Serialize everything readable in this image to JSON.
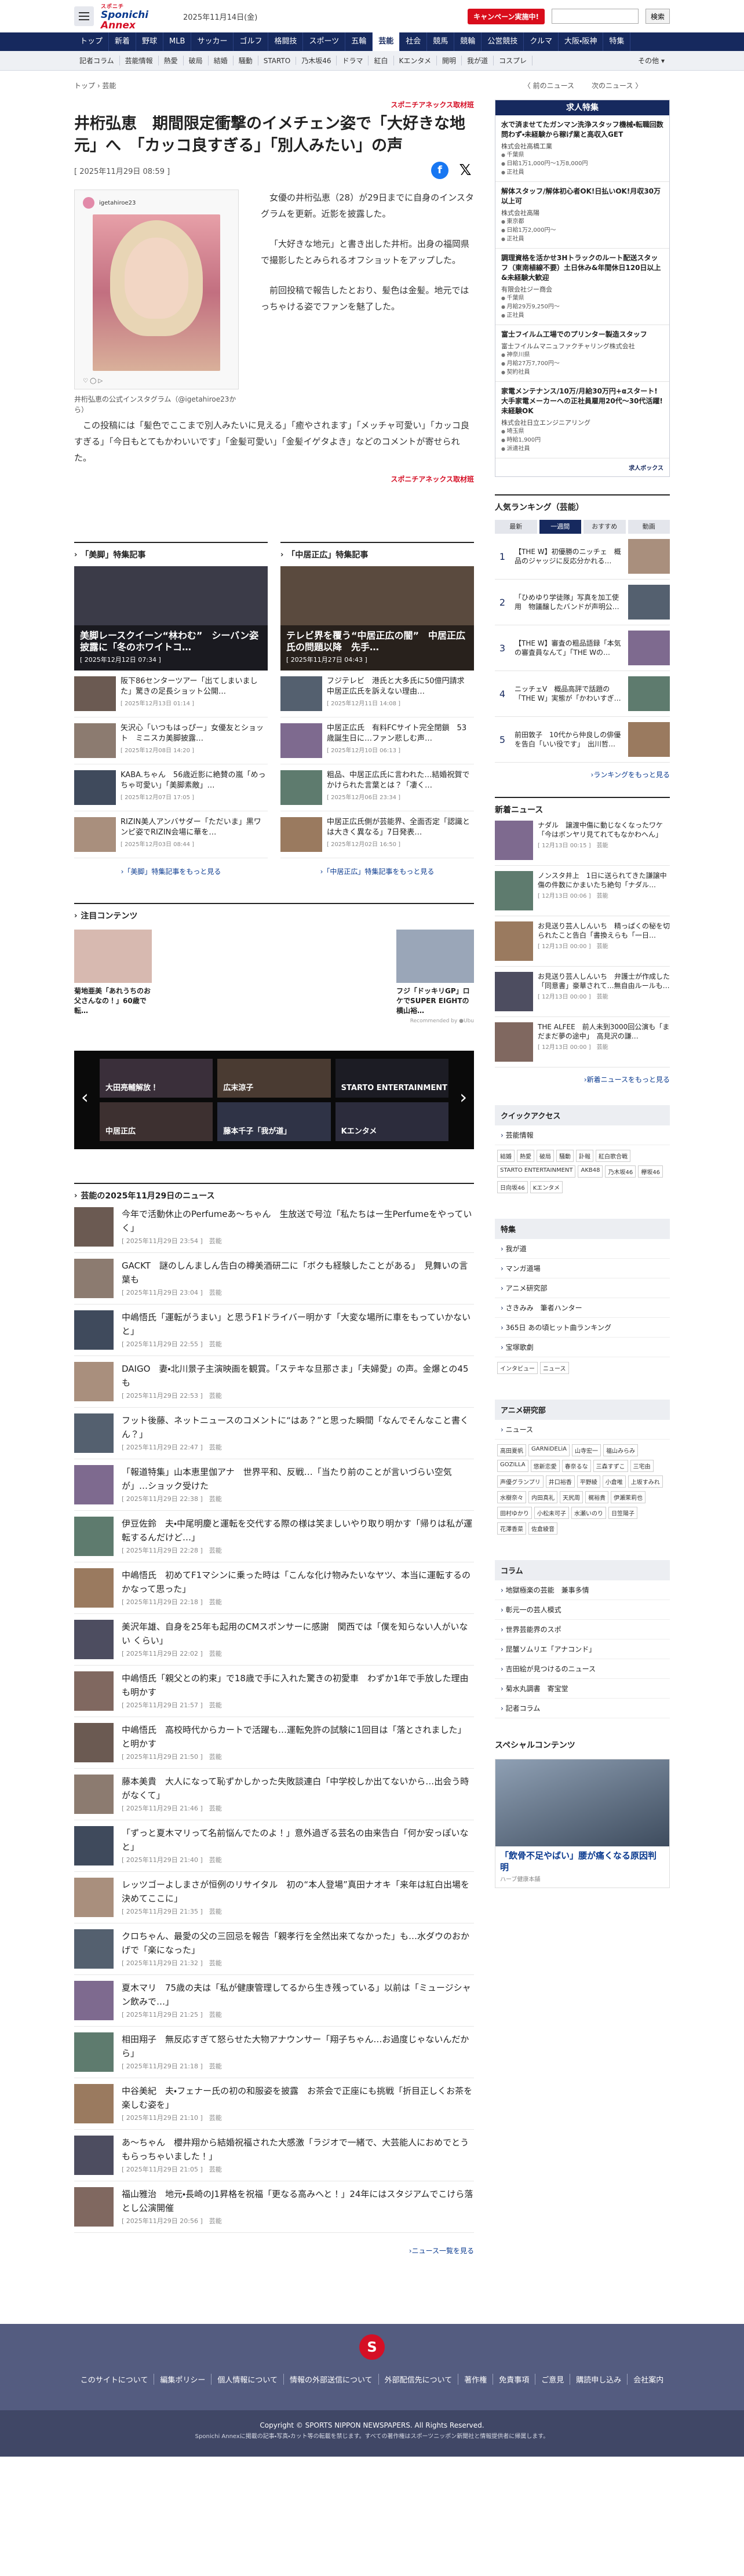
{
  "header": {
    "logo_line1": "スポニチ",
    "logo_line2a": "Sponichi",
    "logo_line2b": "Annex",
    "date": "2025年11月14日(金)",
    "campaign": "キャンペーン実施中!",
    "search_button": "検索"
  },
  "gnav": [
    "トップ",
    "新着",
    "野球",
    "MLB",
    "サッカー",
    "ゴルフ",
    "格闘技",
    "スポーツ",
    "五輪",
    "芸能",
    "社会",
    "競馬",
    "競輪",
    "公営競技",
    "クルマ",
    "大阪・阪神",
    "特集"
  ],
  "subnav": [
    "記者コラム",
    "芸能情報",
    "熱愛",
    "破局",
    "結婚",
    "騒動",
    "STARTO",
    "乃木坂46",
    "ドラマ",
    "紅白",
    "Kエンタメ",
    "開明",
    "我が道",
    "コスプレ"
  ],
  "subnav_more": "その他 ▾",
  "breadcrumb": "トップ  ›  芸能",
  "pager": {
    "prev": "〈  前のニュース",
    "next": "次のニュース  〉"
  },
  "article": {
    "source": "スポニチアネックス取材班",
    "title": "井桁弘恵　期間限定衝撃のイメチェン姿で「大好きな地元」へ　「カッコ良すぎる」「別人みたい」の声",
    "date": "[ 2025年11月29日 08:59 ]",
    "insta_user": "igetahiroe23",
    "insta_caption": "井桁弘恵の公式インスタグラム（@igetahiroe23から）",
    "p1": "女優の井桁弘恵（28）が29日までに自身のインスタグラムを更新。近影を披露した。",
    "p2": "「大好きな地元」と書き出した井桁。出身の福岡県で撮影したとみられるオフショットをアップした。",
    "p3": "前回投稿で報告したとおり、髪色は金髪。地元ではっちゃける姿でファンを魅了した。",
    "p4": "この投稿には「髪色でここまで別人みたいに見える」「癒やされます」「メッチャ可愛い」「カッコ良すぎる」「今日もとてもかわいいです」「金髪可愛い」「金髪イゲタよき」などのコメントが寄せられた。",
    "source2": "スポニチアネックス取材班"
  },
  "features": [
    {
      "head": "「美脚」特集記事",
      "hero_title": "美脚レースクイーン“林わむ”　シーバン姿披露に「冬のホワイトコ…",
      "hero_date": "[ 2025年12月12日 07:34 ]",
      "items": [
        {
          "t": "阪下86センターツアー「出てしまいました」驚きの足長ショット公開…",
          "d": "[ 2025年12月13日 01:14 ]"
        },
        {
          "t": "矢沢心「いつもはっぴー」女優友とショット　ミニスカ美脚披露…",
          "d": "[ 2025年12月08日 14:20 ]"
        },
        {
          "t": "KABA.ちゃん　56歳近影に絶賛の嵐「めっちゃ可愛い」「美脚素敵」…",
          "d": "[ 2025年12月07日 17:05 ]"
        },
        {
          "t": "RIZIN美人アンバサダー「ただいま」黒ワンピ姿でRIZIN会場に華を…",
          "d": "[ 2025年12月03日 08:44 ]"
        }
      ],
      "more": "›「美脚」特集記事をもっと見る"
    },
    {
      "head": "「中居正広」特集記事",
      "hero_title": "テレビ界を覆う“中居正広の闇”　中居正広氏の問題以降　先手…",
      "hero_date": "[ 2025年11月27日 04:43 ]",
      "items": [
        {
          "t": "フジテレビ　港氏と大多氏に50億円請求　中居正広氏を訴えない理由…",
          "d": "[ 2025年12月11日 14:08 ]"
        },
        {
          "t": "中居正広氏　有料FCサイト完全閉鎖　53歳誕生日に…ファン悲しむ声…",
          "d": "[ 2025年12月10日 06:13 ]"
        },
        {
          "t": "粗品、中居正広氏に言われた…結婚祝賀でかけられた言葉とは？「凄く…",
          "d": "[ 2025年12月06日 23:34 ]"
        },
        {
          "t": "中居正広氏側が芸能界、全面否定「認識とは大きく異なる」7日発表…",
          "d": "[ 2025年12月02日 16:50 ]"
        }
      ],
      "more": "›「中居正広」特集記事をもっと見る"
    }
  ],
  "attention": {
    "head": "注目コンテンツ",
    "items": [
      {
        "t": "菊地亜美「あれうちのお父さんなの！」60歳で転…"
      },
      {
        "t": ""
      },
      {
        "t": ""
      },
      {
        "t": "フジ「ドッキリGP」ロケでSUPER EIGHTの横山裕…"
      }
    ],
    "note": "Recommended by ●Ubu"
  },
  "carousel": [
    "大田亮輔解放！",
    "広末涼子",
    "STARTO ENTERTAINMENT",
    "中居正広",
    "藤本千子「我が道」",
    "Kエンタメ"
  ],
  "newslist": {
    "head": "芸能の2025年11月29日のニュース",
    "items": [
      {
        "t": "今年で活動休止のPerfumeあ～ちゃん　生放送で号泣「私たちはー生Perfumeをやっていく」",
        "d": "[ 2025年11月29日 23:54 ]　芸能"
      },
      {
        "t": "GACKT　謎のしんましん告白の樽美酒研二に「ボクも経験したことがある」　見舞いの言葉も",
        "d": "[ 2025年11月29日 23:04 ]　芸能"
      },
      {
        "t": "中嶋悟氏「運転がうまい」と思うF1ドライバー明かす「大変な場所に車をもっていかないと」",
        "d": "[ 2025年11月29日 22:55 ]　芸能"
      },
      {
        "t": "DAIGO　妻・北川景子主演映画を観賞。「ステキな旦那さま」「夫婦愛」の声。金爆との45も",
        "d": "[ 2025年11月29日 22:53 ]　芸能"
      },
      {
        "t": "フット後藤、ネットニュースのコメントに“はあ？”と思った瞬間「なんでそんなこと書くん？」",
        "d": "[ 2025年11月29日 22:47 ]　芸能"
      },
      {
        "t": "「報道特集」山本恵里伽アナ　世界平和、反戦…「当たり前のことが言いづらい空気が」…ショック受けた",
        "d": "[ 2025年11月29日 22:38 ]　芸能"
      },
      {
        "t": "伊豆佐鈴　夫・中尾明慶と運転を交代する際の様は笑ましいやり取り明かす「帰りは私が運転するんだけど…」",
        "d": "[ 2025年11月29日 22:28 ]　芸能"
      },
      {
        "t": "中嶋悟氏　初めてF1マシンに乗った時は「こんな化け物みたいなヤツ、本当に運転するのかなって思った」",
        "d": "[ 2025年11月29日 22:18 ]　芸能"
      },
      {
        "t": "美沢年雄、自身を25年も起用のCMスポンサーに感謝　関西では「僕を知らない人がいない くらい」",
        "d": "[ 2025年11月29日 22:02 ]　芸能"
      },
      {
        "t": "中嶋悟氏「親父との約束」で18歳で手に入れた驚きの初愛車　わずか1年で手放した理由も明かす",
        "d": "[ 2025年11月29日 21:57 ]　芸能"
      },
      {
        "t": "中嶋悟氏　高校時代からカートで活躍も…運転免許の試験に1回目は「落とされました」と明かす",
        "d": "[ 2025年11月29日 21:50 ]　芸能"
      },
      {
        "t": "藤本美貴　大人になって恥ずかしかった失敗談連白「中学校しか出てないから…出会う時がなくて」",
        "d": "[ 2025年11月29日 21:46 ]　芸能"
      },
      {
        "t": "「ずっと夏木マリって名前悩んでたのよ！」意外過ぎる芸名の由来告白「何か安っぽいなと」",
        "d": "[ 2025年11月29日 21:40 ]　芸能"
      },
      {
        "t": "レッツゴーよしまさが恒例のリサイタル　初の“本人登場”真田ナオキ「来年は紅白出場を決めてここに」",
        "d": "[ 2025年11月29日 21:35 ]　芸能"
      },
      {
        "t": "クロちゃん、最愛の父の三回忌を報告「親孝行を全然出来てなかった」も…水ダウのおかげで「楽になった」",
        "d": "[ 2025年11月29日 21:32 ]　芸能"
      },
      {
        "t": "夏木マリ　75歳の夫は「私が健康管理してるから生き残っている」以前は「ミュージシャン飲みで…」",
        "d": "[ 2025年11月29日 21:25 ]　芸能"
      },
      {
        "t": "相田翔子　無反応すぎて怒らせた大物アナウンサー「翔子ちゃん…お過度じゃないんだから」",
        "d": "[ 2025年11月29日 21:18 ]　芸能"
      },
      {
        "t": "中谷美紀　夫・フェナー氏の初の和服姿を披露　お茶会で正座にも挑戦「折目正しくお茶を楽しむ姿を」",
        "d": "[ 2025年11月29日 21:10 ]　芸能"
      },
      {
        "t": "あ～ちゃん　櫻井翔から結婚祝福された大感激「ラジオで一緒で、大芸能人におめでとうもらっちゃいました！」",
        "d": "[ 2025年11月29日 21:05 ]　芸能"
      },
      {
        "t": "福山雅治　地元・長崎のJ1昇格を祝福「更なる高みへと！」24年にはスタジアムでこけら落とし公演開催",
        "d": "[ 2025年11月29日 20:56 ]　芸能"
      }
    ],
    "more": "›ニュース一覧を見る"
  },
  "jobs": {
    "head": "求人特集",
    "items": [
      {
        "t": "水で済ませてたガンマン洗浄スタッフ機械・転職回数問わず・未経験から稼げ業と高収入GET",
        "c": "株式会社高橋工業",
        "rows": [
          "千葉県",
          "日給1万1,000円～1万8,000円",
          "正社員"
        ]
      },
      {
        "t": "解体スタッフ/解体初心者OK!日払いOK!月収30万以上可",
        "c": "株式会社高陽",
        "rows": [
          "東京都",
          "日給1万2,000円～",
          "正社員"
        ]
      },
      {
        "t": "調理資格を活かせ3Hトラックのルート配送スタッフ（東南植線不要）土日休み&年間休日120日以上&未経験大歓迎",
        "c": "有限会社ジー商会",
        "rows": [
          "千葉県",
          "月給29万9,250円～",
          "正社員"
        ]
      },
      {
        "t": "富士フイルム工場でのプリンター製造スタッフ",
        "c": "富士フイルムマニュファクチャリング株式会社",
        "rows": [
          "神奈川県",
          "月給27万7,700円～",
          "契約社員"
        ]
      },
      {
        "t": "家電メンテナンス/10万/月給30万円+αスタート!大手家電メーカーへの正社員雇用20代〜30代活躍!未経験OK",
        "c": "株式会社日立エンジニアリング",
        "rows": [
          "埼玉県",
          "時給1,900円",
          "派遣社員"
        ]
      }
    ],
    "brand": "求人ボックス"
  },
  "ranking": {
    "head": "人気ランキング（芸能）",
    "tabs": [
      "最新",
      "一週間",
      "おすすめ",
      "動画"
    ],
    "items": [
      {
        "n": "1",
        "t": "【THE W】初優勝のニッチェ　概品のジャッジに反応分かれる…"
      },
      {
        "n": "2",
        "t": "「ひめゆり学徒隊」写真を加工使用　物議醸したバンドが声明公…"
      },
      {
        "n": "3",
        "t": "【THE W】審査の粗品語録「本気の審査員なんて」「THE Wの…"
      },
      {
        "n": "4",
        "t": "ニッチェV　概品高評で話題の「THE W」実態が「かわいすぎ…"
      },
      {
        "n": "5",
        "t": "前田敦子　10代から仲良しの俳優を告白「いい役です」　出川哲…"
      }
    ],
    "more": "›ランキングをもっと見る"
  },
  "side_news": {
    "head": "新着ニュース",
    "items": [
      {
        "t": "ナダル　譲渡中傷に動じなくなったワケ「今はボンヤリ見てれてもなかわへん」",
        "d": "[ 12月13日 00:15 ]　芸能"
      },
      {
        "t": "ノンスタ井上　1日に送られてきた謙譲中傷の件数にかまいたち絶句「ナダル…",
        "d": "[ 12月13日 00:06 ]　芸能"
      },
      {
        "t": "お見送り芸人しんいち　精っぱくの秘を切られたこと告白「書換えらも「一日…",
        "d": "[ 12月13日 00:00 ]　芸能"
      },
      {
        "t": "お見送り芸人しんいち　弁護士が作成した「同意書」豪華されて…無自由ルールも…",
        "d": "[ 12月13日 00:00 ]　芸能"
      },
      {
        "t": "THE ALFEE　前人未到3000回公演も「まだまだ夢の途中」　高見沢の謙…",
        "d": "[ 12月13日 00:00 ]　芸能"
      }
    ],
    "more": "›新着ニュースをもっと見る"
  },
  "quick": {
    "head": "クイックアクセス",
    "first": "芸能情報",
    "tags": [
      "結婚",
      "熱愛",
      "破局",
      "騒動",
      "訃報",
      "紅白歌合戦",
      "STARTO ENTERTAINMENT",
      "AKB48",
      "乃木坂46",
      "欅坂46",
      "日向坂46",
      "Kエンタメ"
    ]
  },
  "specials": {
    "head": "特集",
    "items": [
      "我が道",
      "マンガ道場",
      "アニメ研究部",
      "さきみみ　筆者ハンター",
      "365日 あの頃ヒット曲ランキング",
      "宝塚歌劇"
    ],
    "tags": [
      "インタビュー",
      "ニュース"
    ]
  },
  "anime": {
    "head": "アニメ研究部",
    "first": "ニュース",
    "tags": [
      "高田夏帆",
      "GARNiDELiA",
      "山寺宏一",
      "福山みらみ",
      "GOZILLA",
      "悠新恋愛",
      "春奈るな",
      "三森すずこ",
      "三宅由",
      "声優グランプリ",
      "井口裕香",
      "平野綾",
      "小倉唯",
      "上坂すみれ",
      "水樹奈々",
      "内田真礼",
      "天尻周",
      "梶裕貴",
      "伊瀬茉莉也",
      "田村ゆかり",
      "小松未可子",
      "水瀬いのり",
      "日笠陽子",
      "花澤香菜",
      "佐倉綾音"
    ]
  },
  "columns": {
    "head": "コラム",
    "items": [
      "地獄極楽の芸能　兼事多情",
      "彰元一の芸人模式",
      "世界芸能界のスポ",
      "昆蟹ソムリエ「アナコンド」",
      "吉田絵が見つけるのニュース",
      "菊水丸調書　寄宝堂",
      "記者コラム"
    ]
  },
  "special_content": {
    "head": "スペシャルコンテンツ",
    "title": "「飲骨不足やばい」腰が痛くなる原因判明",
    "sub": "ハーブ健康本舗"
  },
  "footer": {
    "logo": "S",
    "links": [
      "このサイトについて",
      "編集ポリシー",
      "個人情報について",
      "情報の外部送信について",
      "外部配信先について",
      "著作権",
      "免責事項",
      "ご意見",
      "購読申し込み",
      "会社案内"
    ],
    "copyright": "Copyright © SPORTS NIPPON NEWSPAPERS. All Rights Reserved.",
    "notice": "Sponichi Annexに掲載の記事・写真・カット等の転載を禁じます。すべての著作権はスポーツニッポン新聞社と情報提供者に帰属します。"
  }
}
